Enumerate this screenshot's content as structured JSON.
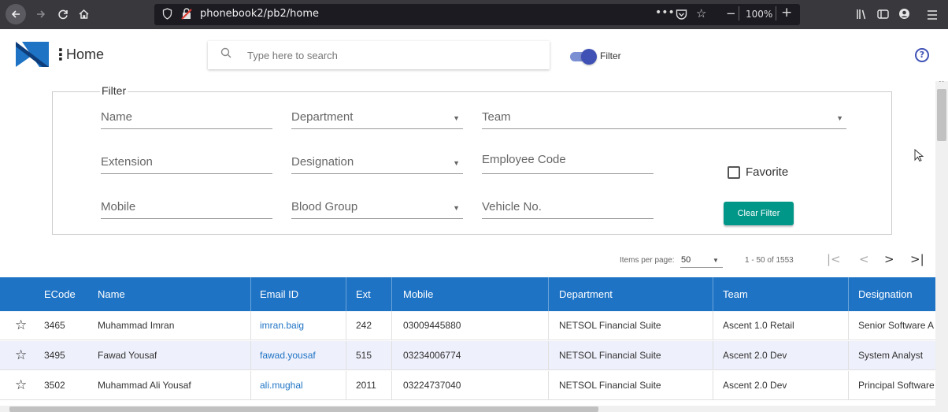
{
  "browser": {
    "url": "phonebook2/pb2/home",
    "zoom": "100%",
    "back_icon": "arrow-left-icon",
    "forward_icon": "arrow-right-icon",
    "reload_icon": "reload-icon",
    "home_icon": "home-icon",
    "more_icon": "•••"
  },
  "header": {
    "title": "Home",
    "search_placeholder": "Type here to search",
    "filter_toggle_label": "Filter",
    "filter_toggle_on": true,
    "help_icon": "?"
  },
  "filter": {
    "legend": "Filter",
    "fields": {
      "name": "Name",
      "department": "Department",
      "team": "Team",
      "extension": "Extension",
      "designation": "Designation",
      "employee_code": "Employee Code",
      "mobile": "Mobile",
      "blood_group": "Blood Group",
      "vehicle_no": "Vehicle No."
    },
    "favorite_label": "Favorite",
    "clear_button": "Clear Filter"
  },
  "pagination": {
    "items_per_page_label": "Items per page:",
    "items_per_page": "50",
    "range": "1 - 50 of 1553",
    "first": "|<",
    "prev": "<",
    "next": ">",
    "last": ">|"
  },
  "table": {
    "headers": {
      "ecode": "ECode",
      "name": "Name",
      "email": "Email ID",
      "ext": "Ext",
      "mobile": "Mobile",
      "department": "Department",
      "team": "Team",
      "designation": "Designation"
    },
    "rows": [
      {
        "ecode": "3465",
        "name": "Muhammad Imran",
        "email": "imran.baig",
        "ext": "242",
        "mobile": "03009445880",
        "department": "NETSOL Financial Suite",
        "team": "Ascent 1.0 Retail",
        "designation": "Senior Software A"
      },
      {
        "ecode": "3495",
        "name": "Fawad Yousaf",
        "email": "fawad.yousaf",
        "ext": "515",
        "mobile": "03234006774",
        "department": "NETSOL Financial Suite",
        "team": "Ascent 2.0 Dev",
        "designation": "System Analyst"
      },
      {
        "ecode": "3502",
        "name": "Muhammad Ali Yousaf",
        "email": "ali.mughal",
        "ext": "2011",
        "mobile": "03224737040",
        "department": "NETSOL Financial Suite",
        "team": "Ascent 2.0 Dev",
        "designation": "Principal Software"
      }
    ]
  },
  "colors": {
    "header_blue": "#1e73c5",
    "accent_indigo": "#3f51b5",
    "button_teal": "#009688"
  }
}
